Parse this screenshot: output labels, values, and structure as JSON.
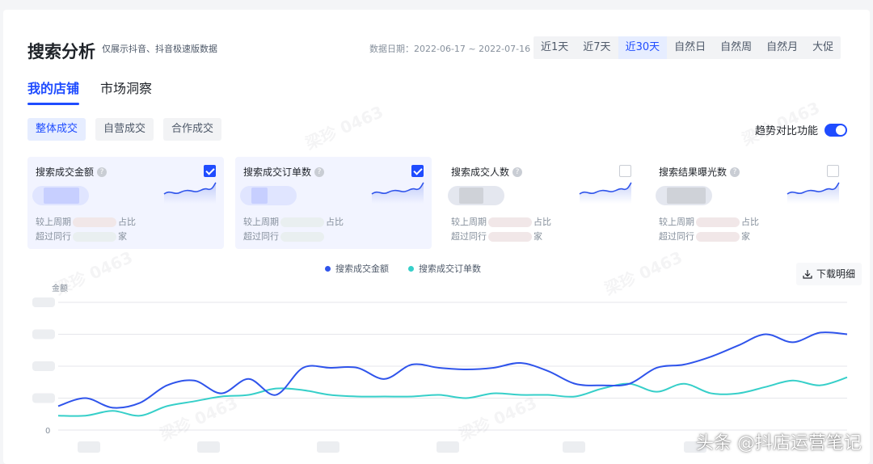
{
  "header": {
    "title": "搜索分析",
    "subtitle": "仅展示抖音、抖音极速版数据",
    "date_range": "数据日期：2022-06-17 ~ 2022-07-16",
    "ranges": [
      "近1天",
      "近7天",
      "近30天",
      "自然日",
      "自然周",
      "自然月",
      "大促"
    ],
    "active_range": "近30天"
  },
  "tabs": [
    {
      "label": "我的店铺",
      "active": true
    },
    {
      "label": "市场洞察",
      "active": false
    }
  ],
  "sub_tabs": [
    {
      "label": "整体成交",
      "active": true
    },
    {
      "label": "自营成交",
      "active": false
    },
    {
      "label": "合作成交",
      "active": false
    }
  ],
  "compare_toggle": {
    "label": "趋势对比功能",
    "on": true
  },
  "metrics": [
    {
      "label": "搜索成交金额",
      "checked": true,
      "line1_a": "较上周期",
      "line1_b": "占比",
      "line2": "超过同行",
      "line2_b": "家"
    },
    {
      "label": "搜索成交订单数",
      "checked": true,
      "line1_a": "较上周期",
      "line1_b": "占比",
      "line2": "超过同行",
      "line2_b": ""
    },
    {
      "label": "搜索成交人数",
      "checked": false,
      "line1_a": "较上周期",
      "line1_b": "占比",
      "line2": "超过同行",
      "line2_b": "家"
    },
    {
      "label": "搜索结果曝光数",
      "checked": false,
      "line1_a": "较上周期",
      "line1_b": "占比",
      "line2": "超过同行",
      "line2_b": "家"
    }
  ],
  "download_label": "下载明细",
  "watermark_text": "梁珍 0463",
  "signature": "头条 @抖店运营笔记",
  "colors": {
    "accent": "#1f4cff",
    "series_1": "#2f54eb",
    "series_2": "#36cfc9"
  },
  "chart_data": {
    "type": "line",
    "ylabel": "金额",
    "y_ticks": [
      "0"
    ],
    "ylim": [
      0,
      4
    ],
    "x": [
      1,
      2,
      3,
      4,
      5,
      6,
      7,
      8,
      9,
      10,
      11,
      12,
      13,
      14,
      15,
      16,
      17,
      18,
      19,
      20,
      21,
      22,
      23,
      24,
      25,
      26,
      27,
      28,
      29,
      30
    ],
    "series": [
      {
        "name": "搜索成交金额",
        "color": "#2f54eb",
        "values": [
          0.75,
          1.0,
          0.7,
          0.85,
          1.4,
          1.55,
          1.15,
          1.6,
          1.1,
          1.95,
          1.95,
          1.95,
          1.6,
          2.05,
          1.95,
          1.9,
          1.95,
          2.1,
          1.85,
          1.45,
          1.4,
          1.45,
          1.95,
          2.05,
          2.3,
          2.65,
          3.0,
          2.75,
          3.05,
          3.0
        ]
      },
      {
        "name": "搜索成交订单数",
        "color": "#36cfc9",
        "values": [
          0.45,
          0.45,
          0.6,
          0.45,
          0.75,
          0.9,
          1.05,
          1.1,
          1.3,
          1.25,
          1.1,
          1.05,
          1.05,
          1.05,
          1.1,
          1.0,
          1.15,
          1.1,
          1.1,
          1.05,
          1.3,
          1.45,
          1.2,
          1.45,
          1.15,
          1.15,
          1.35,
          1.55,
          1.4,
          1.65
        ]
      }
    ]
  }
}
